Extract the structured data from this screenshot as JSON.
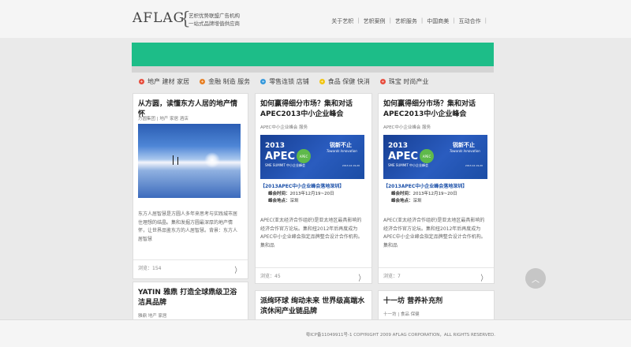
{
  "header": {
    "logo_text": "AFLAG",
    "tagline_line1": "艺帜优势联盟广告机构",
    "tagline_line2": "一站式品牌增值供应商",
    "nav": [
      "关于艺帜",
      "艺帜案例",
      "艺帜服务",
      "中国商美",
      "互动合作"
    ]
  },
  "categories": [
    {
      "label": "地产 建材 家居",
      "color": "#e74c3c"
    },
    {
      "label": "金融 制造 服务",
      "color": "#e67e22"
    },
    {
      "label": "零售连锁 店铺",
      "color": "#3498db"
    },
    {
      "label": "食品 保健 快消",
      "color": "#f1c40f"
    },
    {
      "label": "珠宝 时尚产业",
      "color": "#e74c3c"
    }
  ],
  "cards": {
    "c1": {
      "title": "从方圆，读懂东方人居的地产情怀",
      "meta": "方圆集团 | 地产 家居 酒店",
      "desc": "东方人居智慧是方圆人多年来思考与实践城市居住理想的结晶。集和发掘方圆最深厚的地产情怀，让世界品鉴东方的人居智慧。背景：东方人居智慧",
      "views": "浏览：154"
    },
    "c2": {
      "title": "如何赢得细分市场？集和对话APEC2013中小企业峰会",
      "meta": "APEC中小企业峰会 服务",
      "desc": "APEC(亚太经济合作组织)是亚太地区最具影响的经济合作官方论坛。集和扭2012年后再度成为APEC中小企业峰会指定品牌整合设计合作机构。集和品",
      "views": "浏览：45"
    },
    "c3": {
      "title": "如何赢得细分市场？集和对话APEC2013中小企业峰会",
      "meta": "APEC中小企业峰会 服务",
      "desc": "APEC(亚太经济合作组织)是亚太地区最具影响的经济合作官方论坛。集和扭2012年后再度成为APEC中小企业峰会指定品牌整合设计合作机构。集和品",
      "views": "浏览：7"
    },
    "c4": {
      "title": "YATIN 雅鼎 打造全球鼎级卫浴洁具品牌",
      "meta": "雅鼎 地产 家居"
    },
    "c5": {
      "title": "派绚环球 绚动未来 世界级高端水滨休闲产业链品牌",
      "meta": ""
    },
    "c6": {
      "title": "十一坊 营养补充剂",
      "meta": "十一坊 | 食品 保健"
    }
  },
  "apec": {
    "year": "2013",
    "name": "APEC",
    "subtitle": "SME SUMMIT 中小企业峰会",
    "badge": "APEC",
    "slogan": "锐新不止",
    "slogan_en": "Towards Innovation",
    "date": "2013.12.19-20",
    "headline": "【2013APEC中小企业峰会落地深圳】",
    "time_label": "峰会时间：",
    "time_value": "2013年12月19~20日",
    "place_label": "峰会地点：",
    "place_value": "深圳"
  },
  "footer": "粤ICP备11049911号-1 COPYRIGHT 2009 AFLAG CORPORATION，ALL RIGHTS RESERVED.",
  "scroll_top_glyph": "︿"
}
